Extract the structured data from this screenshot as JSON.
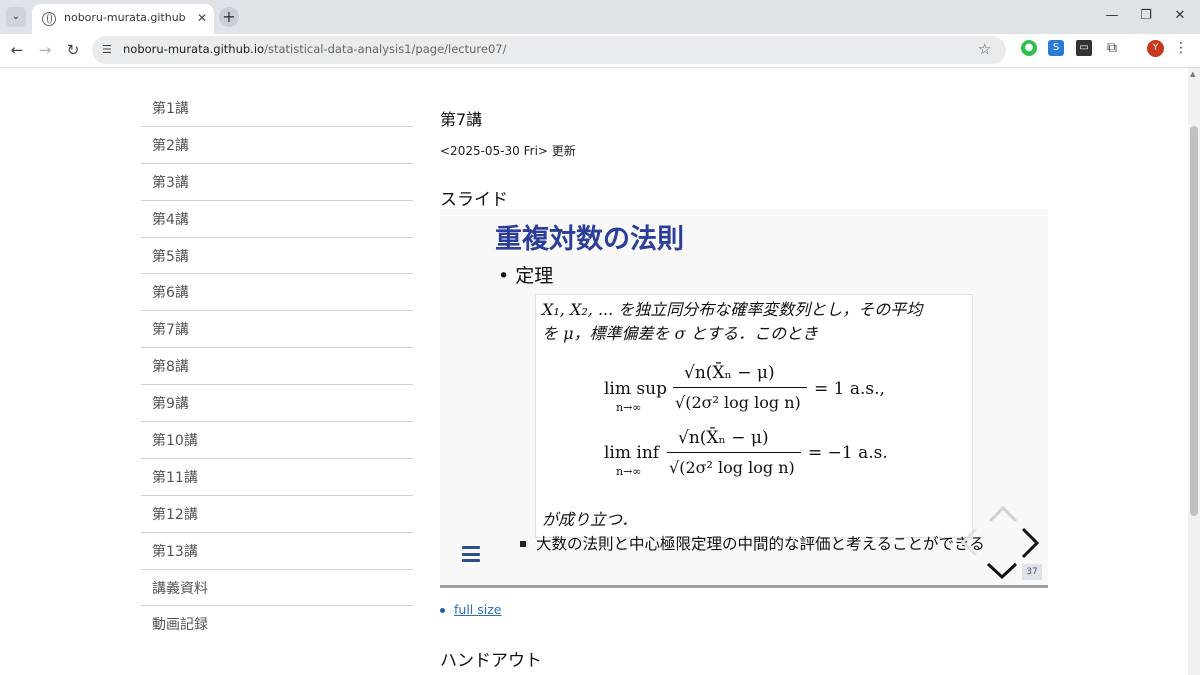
{
  "browser": {
    "tab_title": "noboru-murata.github.io/statist",
    "url_domain": "noboru-murata.github.io",
    "url_path": "/statistical-data-analysis1/page/lecture07/",
    "avatar_letter": "Y"
  },
  "sidebar": {
    "items": [
      "第1講",
      "第2講",
      "第3講",
      "第4講",
      "第5講",
      "第6講",
      "第7講",
      "第8講",
      "第9講",
      "第10講",
      "第11講",
      "第12講",
      "第13講",
      "講義資料",
      "動画記録"
    ]
  },
  "main": {
    "title": "第7講",
    "update": "<2025-05-30 Fri> 更新",
    "section_slide": "スライド",
    "section_handout": "ハンドアウト",
    "link_full_size": "full size"
  },
  "slide": {
    "title": "重複対数の法則",
    "bullet": "• 定理",
    "theorem_line1": "X₁, X₂, ... を独立同分布な確率変数列とし，その平均",
    "theorem_line2": "を μ，標準偏差を σ とする．このとき",
    "eq1_lhs": "lim sup",
    "eq1_sub": "n→∞",
    "eq1_num": "√n(X̄ₙ − μ)",
    "eq1_den": "√(2σ² log log n)",
    "eq1_rhs": "= 1    a.s.,",
    "eq2_lhs": "lim inf",
    "eq2_sub": "n→∞",
    "eq2_num": "√n(X̄ₙ − μ)",
    "eq2_den": "√(2σ² log log n)",
    "eq2_rhs": "= −1    a.s.",
    "theorem_tail": "が成り立つ．",
    "sub_bullet": "大数の法則と中心極限定理の中間的な評価と考えることができる",
    "slide_number": "37",
    "title_color": "#2c3e9a"
  }
}
